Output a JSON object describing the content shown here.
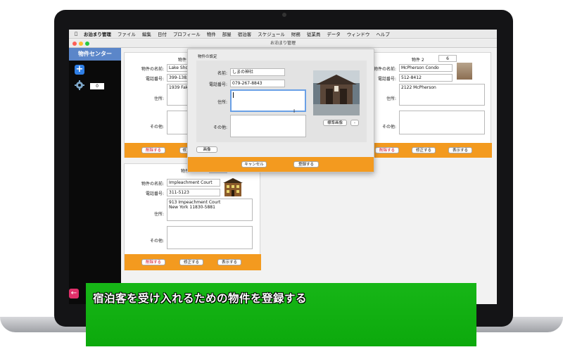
{
  "menubar": {
    "app_name": "お泊まり管理",
    "items": [
      "ファイル",
      "編集",
      "日付",
      "プロフィール",
      "物件",
      "部屋",
      "宿泊客",
      "スケジュール",
      "財務",
      "従業員",
      "データ",
      "ウィンドウ",
      "ヘルプ"
    ]
  },
  "window_title": "お泊まり管理",
  "sidebar": {
    "title": "物件センター",
    "count": "0"
  },
  "cards": [
    {
      "number_label": "物件 1",
      "number": "",
      "name_label": "物件の名前:",
      "name": "Lake Sho",
      "phone_label": "電話番号:",
      "phone": "399-1383",
      "address_label": "住所:",
      "address": "1939 Fak",
      "other_label": "その他:",
      "other": "",
      "delete": "削除する",
      "edit": "修正",
      "show": ""
    },
    {
      "number_label": "物件 2",
      "number": "6",
      "name_label": "物件の名前:",
      "name": "McPherson Condo",
      "phone_label": "電話番号:",
      "phone": "512-8412",
      "address_label": "住所:",
      "address": "2122 McPherson",
      "other_label": "その他:",
      "other": "",
      "delete": "削除する",
      "edit": "修正する",
      "show": "表示する"
    },
    {
      "number_label": "物件 3",
      "number": "0",
      "name_label": "物件の名前:",
      "name": "Impleachment Court",
      "phone_label": "電話番号:",
      "phone": "311-5123",
      "address_label": "住所:",
      "address": "913 Impeachment Court\nNew York 11830-5881",
      "other_label": "その他:",
      "other": "",
      "delete": "削除する",
      "edit": "修正する",
      "show": "表示する"
    }
  ],
  "modal": {
    "title": "物件の設定",
    "name_label": "名前:",
    "name": "しまの神社",
    "phone_label": "電話番号:",
    "phone": "079-267-8843",
    "address_label": "住所:",
    "address": "",
    "other_label": "その他:",
    "other": "",
    "standard_image": "標準画像",
    "minus": "-",
    "image_button": "画像",
    "cancel": "キャンセル",
    "register": "登録する"
  },
  "caption": "宿泊客を受け入れるための物件を登録する",
  "colors": {
    "orange": "#f39a1f",
    "sidebar_header": "#5b86c9",
    "caption_green": "#10b010"
  }
}
